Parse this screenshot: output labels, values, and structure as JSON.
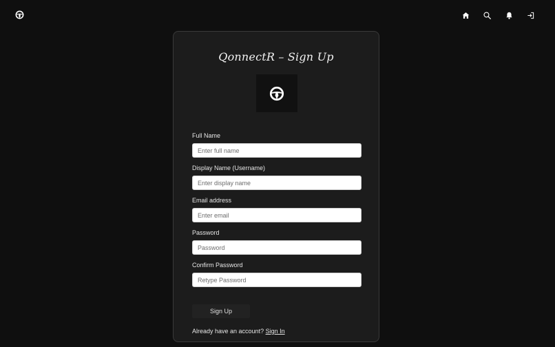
{
  "header": {
    "logo_icon": "steering-wheel-icon",
    "nav_icons": [
      "home-icon",
      "search-icon",
      "bell-icon",
      "login-icon"
    ]
  },
  "form": {
    "title": "QonnectR – Sign Up",
    "logo_icon": "steering-wheel-icon",
    "fields": [
      {
        "label": "Full Name",
        "placeholder": "Enter full name"
      },
      {
        "label": "Display Name (Username)",
        "placeholder": "Enter display name"
      },
      {
        "label": "Email address",
        "placeholder": "Enter email"
      },
      {
        "label": "Password",
        "placeholder": "Password"
      },
      {
        "label": "Confirm Password",
        "placeholder": "Retype Password"
      }
    ],
    "submit_label": "Sign Up",
    "footer_text": "Already have an account?",
    "footer_link": "Sign In"
  },
  "colors": {
    "background": "#0f0f0f",
    "card": "#1c1c1c",
    "card_border": "#3a3a3a",
    "button": "#222222"
  }
}
